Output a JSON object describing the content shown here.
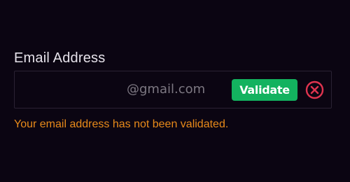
{
  "email_field": {
    "label": "Email Address",
    "value": "",
    "placeholder": "",
    "domain_suffix": "@gmail.com"
  },
  "actions": {
    "validate_label": "Validate",
    "clear_icon": "close-circle-icon"
  },
  "status": {
    "message": "Your email address has not been validated.",
    "message_color": "#e88a1a"
  },
  "colors": {
    "background": "#0b0512",
    "validate_button": "#13b25f",
    "clear_icon": "#e0344f",
    "suffix_text": "#7d7882"
  }
}
